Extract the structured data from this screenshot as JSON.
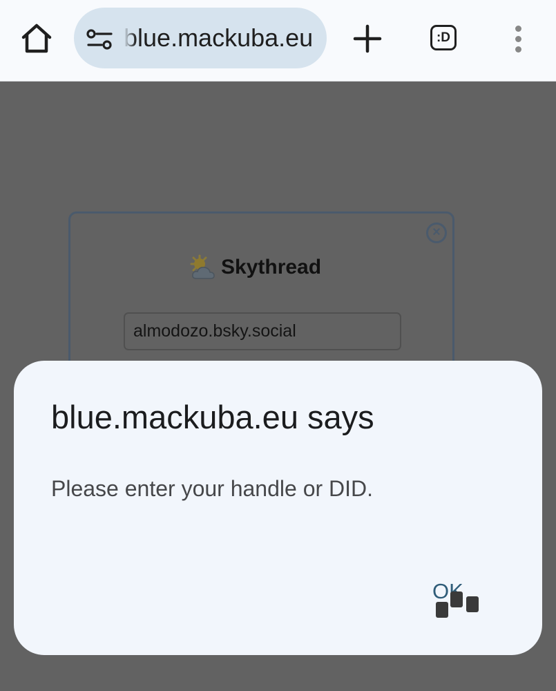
{
  "browser": {
    "url": "blue.mackuba.eu",
    "tab_count": ":D",
    "icons": {
      "home": "home-icon",
      "site_settings": "tune-icon",
      "new_tab": "plus-icon",
      "tab_switcher": "tab-switcher-icon",
      "menu": "more-vert-icon"
    }
  },
  "page": {
    "logo_icon": "sun-behind-cloud-icon",
    "title": "Skythread",
    "handle_value": "almodozo.bsky.social",
    "close_icon": "close-circle-icon",
    "close_glyph": "×"
  },
  "dialog": {
    "title": "blue.mackuba.eu says",
    "message": "Please enter your handle or DID.",
    "ok_label": "OK"
  },
  "colors": {
    "toolbar_bg": "#f8fafd",
    "omnibox_bg": "#d6e3ee",
    "scrim": "#626262",
    "dialog_bg": "#f2f6fc",
    "ok_text": "#2f5c78"
  }
}
